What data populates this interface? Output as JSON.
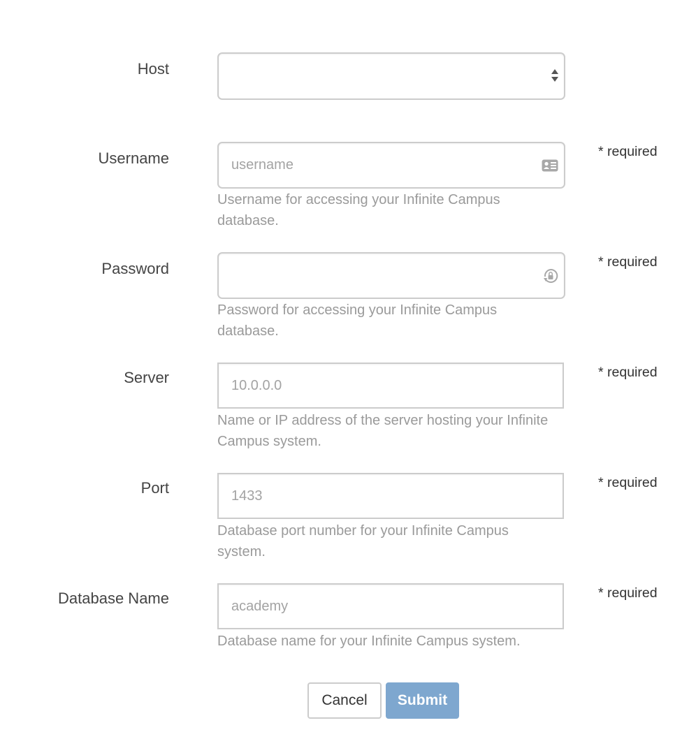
{
  "form": {
    "fields": [
      {
        "id": "host",
        "label": "Host",
        "type": "select",
        "value": "",
        "placeholder": "",
        "help": "",
        "required_label": ""
      },
      {
        "id": "username",
        "label": "Username",
        "type": "text",
        "value": "",
        "placeholder": "username",
        "help": "Username for accessing your Infinite Campus database.",
        "required_label": "* required",
        "icon": "contact-card-icon"
      },
      {
        "id": "password",
        "label": "Password",
        "type": "password",
        "value": "",
        "placeholder": "",
        "help": "Password for accessing your Infinite Campus database.",
        "required_label": "* required",
        "icon": "password-manager-icon"
      },
      {
        "id": "server",
        "label": "Server",
        "type": "text",
        "value": "",
        "placeholder": "10.0.0.0",
        "help": "Name or IP address of the server hosting your Infinite Campus system.",
        "required_label": "* required"
      },
      {
        "id": "port",
        "label": "Port",
        "type": "text",
        "value": "",
        "placeholder": "1433",
        "help": "Database port number for your Infinite Campus system.",
        "required_label": "* required"
      },
      {
        "id": "database_name",
        "label": "Database Name",
        "type": "text",
        "value": "",
        "placeholder": "academy",
        "help": "Database name for your Infinite Campus system.",
        "required_label": "* required"
      }
    ]
  },
  "actions": {
    "cancel_label": "Cancel",
    "submit_label": "Submit",
    "submit_color": "#7ea7cf"
  }
}
